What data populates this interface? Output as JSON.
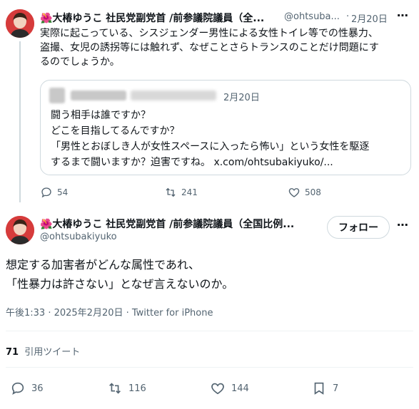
{
  "tweet1": {
    "avatar_alt": "",
    "name": "🌺大椿ゆうこ 社民党副党首 /前参議院議員（全...",
    "handle": "@ohtsuba...",
    "sep": "·",
    "date": "2月20日",
    "more_icon": "more-horizontal-icon",
    "text_lines": [
      "実際に起こっている、シスジェンダー男性による女性トイレ等での性暴力、",
      "盗撮、女児の誘拐等には触れず、なぜことさらトランスのことだけ問題にす",
      "るのでしょうか。"
    ],
    "quote": {
      "date": "2月20日",
      "lines": [
        "闘う相手は誰ですか？",
        "どこを目指してるんですか？",
        "「男性とおぼしき人が女性スペースに入ったら怖い」という女性を駆逐",
        "するまで闘いますか？迫害ですね。 x.com/ohtsubakiyuko/..."
      ]
    },
    "actions": {
      "replies": "54",
      "retweets": "241",
      "likes": "508"
    }
  },
  "tweet2": {
    "name": "🌺大椿ゆうこ 社民党副党首 /前参議院議員（全国比例...",
    "handle": "@ohtsubakiyuko",
    "follow_label": "フォロー",
    "text_lines": [
      "想定する加害者がどんな属性であれ、",
      "「性暴力は許さない」となぜ言えないのか。"
    ],
    "meta": "午後1:33 · 2025年2月20日 · Twitter for iPhone",
    "quote_count": "71",
    "quote_label": "引用ツイート",
    "actions": {
      "replies": "36",
      "retweets": "116",
      "likes": "144",
      "bookmarks": "7"
    }
  },
  "colors": {
    "text": "#0f1419",
    "muted": "#536471",
    "border": "#cfd9de",
    "divider": "#eff3f4"
  }
}
